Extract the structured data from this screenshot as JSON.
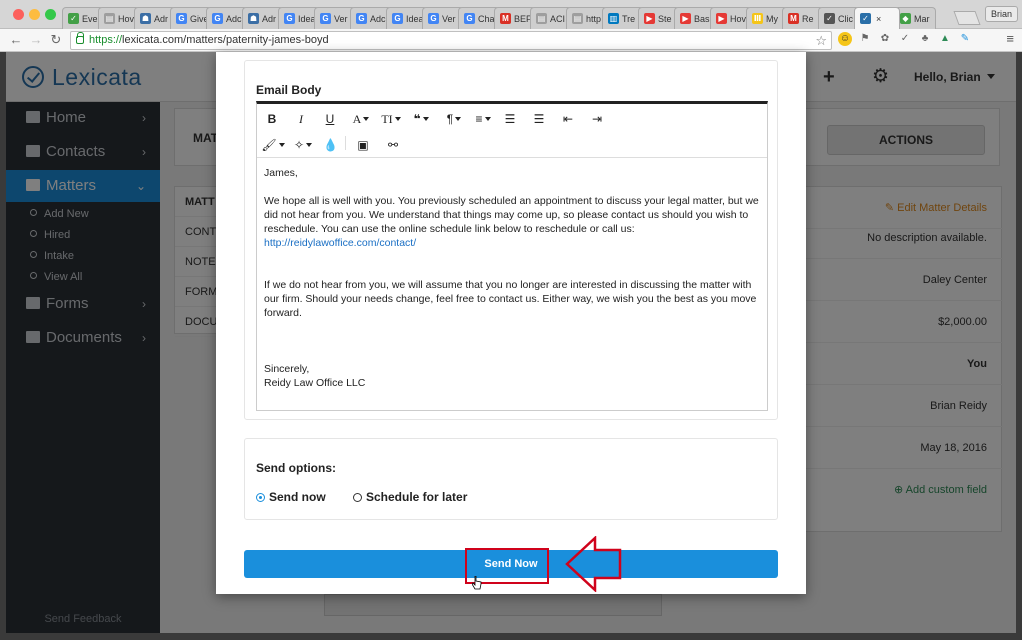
{
  "browser": {
    "tabs": [
      {
        "label": "Eve",
        "fav_color": "#43a047",
        "fav": "✓"
      },
      {
        "label": "Hov",
        "fav_color": "#9e9e9e",
        "fav": "▤"
      },
      {
        "label": "Adr",
        "fav_color": "#3b6ea5",
        "fav": "☗"
      },
      {
        "label": "Give",
        "fav_color": "#4285f4",
        "fav": "G"
      },
      {
        "label": "Adc",
        "fav_color": "#4285f4",
        "fav": "G"
      },
      {
        "label": "Adr",
        "fav_color": "#3b6ea5",
        "fav": "☗"
      },
      {
        "label": "Idea",
        "fav_color": "#4285f4",
        "fav": "G"
      },
      {
        "label": "Ver",
        "fav_color": "#4285f4",
        "fav": "G"
      },
      {
        "label": "Adc",
        "fav_color": "#4285f4",
        "fav": "G"
      },
      {
        "label": "Idea",
        "fav_color": "#4285f4",
        "fav": "G"
      },
      {
        "label": "Ver",
        "fav_color": "#4285f4",
        "fav": "G"
      },
      {
        "label": "Cha",
        "fav_color": "#4285f4",
        "fav": "G"
      },
      {
        "label": "BEF",
        "fav_color": "#d93025",
        "fav": "M"
      },
      {
        "label": "ACI",
        "fav_color": "#9e9e9e",
        "fav": "▤"
      },
      {
        "label": "http",
        "fav_color": "#9e9e9e",
        "fav": "▤"
      },
      {
        "label": "Tre",
        "fav_color": "#0079bf",
        "fav": "▥"
      },
      {
        "label": "Ste",
        "fav_color": "#e53935",
        "fav": "▶"
      },
      {
        "label": "Bas",
        "fav_color": "#e53935",
        "fav": "▶"
      },
      {
        "label": "Hov",
        "fav_color": "#e53935",
        "fav": "▶"
      },
      {
        "label": "My",
        "fav_color": "#f5c518",
        "fav": "Ⅲ"
      },
      {
        "label": "Re",
        "fav_color": "#d93025",
        "fav": "M"
      },
      {
        "label": "Clic",
        "fav_color": "#555555",
        "fav": "✓"
      },
      {
        "label": "",
        "fav_color": "#2a6fa8",
        "fav": "✓",
        "active": true
      },
      {
        "label": "Mar",
        "fav_color": "#43a047",
        "fav": "◆"
      }
    ],
    "profile": "Brian",
    "url_scheme": "https://",
    "url_rest": "lexicata.com/matters/paternity-james-boyd"
  },
  "app": {
    "logo": "Lexicata",
    "user_greeting": "Hello, Brian",
    "sidebar": {
      "items": [
        {
          "label": "Home"
        },
        {
          "label": "Contacts"
        },
        {
          "label": "Matters"
        },
        {
          "label": "Forms"
        },
        {
          "label": "Documents"
        }
      ],
      "subitems": [
        "Add New",
        "Hired",
        "Intake",
        "View All"
      ],
      "feedback": "Send Feedback"
    },
    "matter_header": "MAT",
    "actions_label": "ACTIONS",
    "left_tabs": [
      "MATT",
      "CONT",
      "NOTES",
      "FORM",
      "DOCU"
    ],
    "right_panel": {
      "edit": "✎ Edit Matter Details",
      "rows": [
        "No description available.",
        "Daley Center",
        "$2,000.00",
        "You",
        "Brian Reidy",
        "May 18, 2016"
      ],
      "add": "⊕ Add custom field"
    }
  },
  "modal": {
    "email_body_label": "Email Body",
    "body": {
      "greeting": "James,",
      "p1": "We hope all is well with you. You previously scheduled an appointment to discuss your legal matter, but we did not hear from you. We understand that things may come up, so please contact us should you wish to reschedule. You can use the online schedule link below to reschedule or call us:",
      "link": "http://reidylawoffice.com/contact/",
      "p2": "If we do not hear from you, we will assume that you no longer are interested in discussing the matter with our firm. Should your needs change, feel free to contact us.  Either way, we wish you the best as you move forward.",
      "sign1": "Sincerely,",
      "sign2": "Reidy Law Office LLC"
    },
    "send_options_label": "Send options:",
    "opt_now": "Send now",
    "opt_later": "Schedule for later",
    "send_button": "Send Now"
  },
  "colors": {
    "primary": "#1a8fdc",
    "highlight": "#d0021b"
  }
}
